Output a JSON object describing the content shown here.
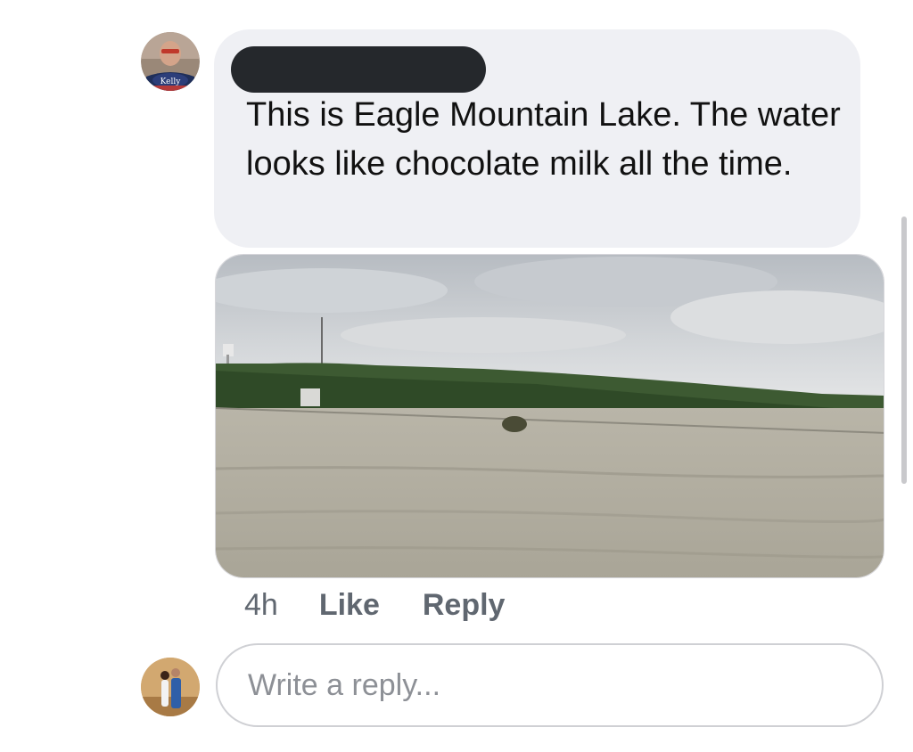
{
  "comment": {
    "text": "This is Eagle Mountain Lake. The water looks like chocolate milk all the time.",
    "timestamp": "4h",
    "like_label": "Like",
    "reply_label": "Reply"
  },
  "reply_input": {
    "placeholder": "Write a reply..."
  },
  "icons": {
    "commenter_avatar": "profile-photo",
    "viewer_avatar": "profile-photo"
  }
}
